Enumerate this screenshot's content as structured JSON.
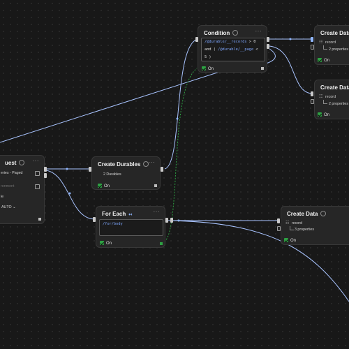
{
  "nodes": {
    "condition": {
      "title": "Condition",
      "expr": {
        "line1_var": "/@durable/__records",
        "line1_op": ">",
        "line1_val": "0",
        "line2_prefix": "and (",
        "line2_var": "/@durable/__page",
        "line2_op": "<",
        "line3_val": "5",
        "line3_close": ")"
      },
      "toggle_label": "On"
    },
    "create_data_1": {
      "title": "Create Data",
      "record_label": "record",
      "properties": "2 properties",
      "toggle_label": "On"
    },
    "create_data_2": {
      "title": "Create Data",
      "record_label": "record",
      "properties": "2 properties",
      "toggle_label": "On"
    },
    "request": {
      "title": "uest",
      "row1": "eries - Paged",
      "row2": "ronment",
      "row3": "le",
      "row4": "AUTO"
    },
    "create_durables": {
      "title": "Create Durables",
      "count": "2 Durables",
      "toggle_label": "On"
    },
    "for_each": {
      "title": "For Each",
      "path": "/for/body",
      "toggle_label": "On"
    },
    "create_data_3": {
      "title": "Create Data",
      "record_label": "record",
      "properties": "3 properties",
      "toggle_label": "On"
    }
  },
  "colors": {
    "edge": "#a9c4ff",
    "edge_dashed": "#2ea043",
    "toggle_on": "#2ea043",
    "canvas_bg": "#181818"
  },
  "icons": [
    "info-icon",
    "menu-dots-icon",
    "external-link-icon",
    "chevron-down-icon",
    "grid-icon",
    "tree-connector-icon",
    "loop-icon"
  ]
}
